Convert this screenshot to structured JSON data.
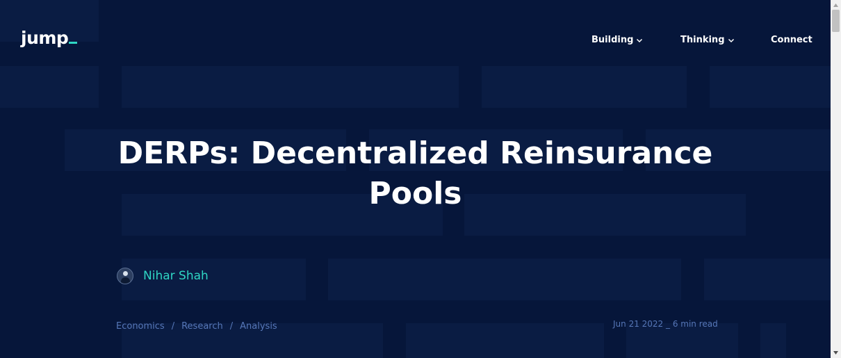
{
  "brand": {
    "logo_text": "jump",
    "accent": "#2fd6c4"
  },
  "nav": {
    "building": "Building",
    "thinking": "Thinking",
    "connect": "Connect"
  },
  "article": {
    "title": "DERPs: Decentralized Reinsurance Pools",
    "author": "Nihar Shah",
    "tags": [
      "Economics",
      "Research",
      "Analysis"
    ],
    "tag_separator": "/",
    "meta": "Jun 21 2022 _ 6 min read"
  },
  "colors": {
    "background": "#06163a",
    "tile": "#0a1c43",
    "text": "#ffffff",
    "muted": "#5677b8"
  },
  "icons": {
    "nav_dropdown": "chevron-down-icon",
    "avatar": "avatar",
    "scroll_up": "triangle-up-icon",
    "scroll_down": "triangle-down-icon"
  }
}
